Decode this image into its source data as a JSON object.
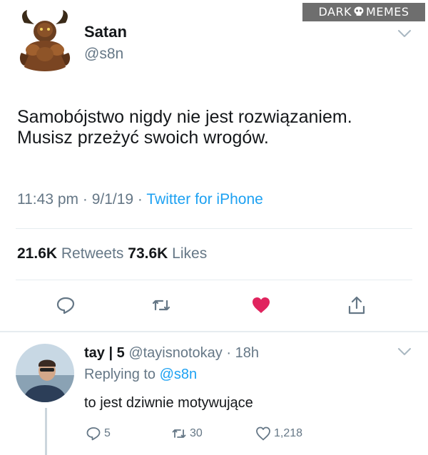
{
  "watermark": {
    "left": "DARK",
    "right": "MEMES"
  },
  "tweet": {
    "author_name": "Satan",
    "author_handle": "@s8n",
    "text_lines": [
      "Samobójstwo nigdy nie jest rozwiązaniem.",
      "Musisz przeżyć swoich wrogów."
    ],
    "time": "11:43 pm",
    "date": "9/1/19",
    "source": "Twitter for iPhone",
    "retweets_count": "21.6K",
    "retweets_label": "Retweets",
    "likes_count": "73.6K",
    "likes_label": "Likes",
    "actions": [
      "reply-icon",
      "retweet-icon",
      "like-icon",
      "share-icon"
    ],
    "liked": true
  },
  "reply": {
    "author_name": "tay | 5",
    "author_handle": "@tayisnotokay",
    "time": "18h",
    "replying_prefix": "Replying to",
    "replying_to": "@s8n",
    "text": "to jest dziwnie motywujące",
    "reply_count": "5",
    "retweet_count": "30",
    "like_count": "1,218"
  },
  "colors": {
    "link_blue": "#1da1f2",
    "secondary_gray": "#657786",
    "like_red": "#e0245e",
    "divider": "#e6ecf0"
  }
}
